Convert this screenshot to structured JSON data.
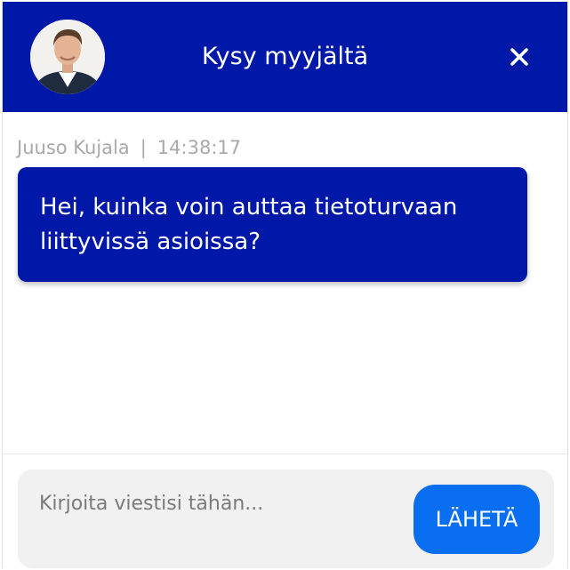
{
  "header": {
    "title": "Kysy myyjältä",
    "avatar_icon": "agent-portrait",
    "close_icon": "close-icon"
  },
  "message": {
    "author": "Juuso Kujala",
    "separator": "|",
    "time": "14:38:17",
    "text": "Hei, kuinka voin auttaa tietoturvaan liittyvissä asioissa?"
  },
  "composer": {
    "placeholder": "Kirjoita viestisi tähän...",
    "value": "",
    "send_label": "LÄHETÄ"
  },
  "colors": {
    "brand_blue": "#0018a8",
    "send_button": "#0a6ef0",
    "meta_text": "#a9a9a9",
    "composer_bg": "#f1f1f1"
  }
}
